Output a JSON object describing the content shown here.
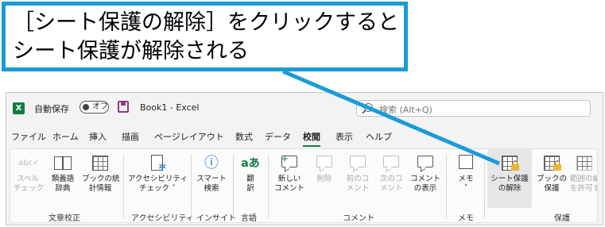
{
  "callout": {
    "line1": "［シート保護の解除］をクリックすると",
    "line2": "シート保護が解除される",
    "color": "#1a9bd7"
  },
  "titlebar": {
    "app_icon": "excel-icon",
    "autosave_label": "自動保存",
    "autosave_state": "オフ",
    "doc_title": "Book1  -  Excel",
    "search_placeholder": "検索 (Alt+Q)"
  },
  "tabs": [
    "ファイル",
    "ホーム",
    "挿入",
    "描画",
    "ページレイアウト",
    "数式",
    "データ",
    "校閲",
    "表示",
    "ヘルプ"
  ],
  "active_tab": "校閲",
  "ribbon": {
    "groups": [
      {
        "label": "文章校正",
        "commands": [
          {
            "icon": "spellcheck-icon",
            "l1": "スペル",
            "l2": "チェック",
            "disabled": true
          },
          {
            "icon": "thesaurus-icon",
            "l1": "類義語",
            "l2": "辞典",
            "disabled": false
          },
          {
            "icon": "workbook-statistics-icon",
            "l1": "ブックの統",
            "l2": "計情報",
            "disabled": false
          }
        ]
      },
      {
        "label": "アクセシビリティ",
        "commands": [
          {
            "icon": "accessibility-icon",
            "l1": "アクセシビリティ",
            "l2": "チェック ˅",
            "disabled": false
          }
        ]
      },
      {
        "label": "インサイト",
        "commands": [
          {
            "icon": "smart-lookup-icon",
            "l1": "スマート",
            "l2": "検索",
            "disabled": false
          }
        ]
      },
      {
        "label": "言語",
        "commands": [
          {
            "icon": "translate-icon",
            "l1": "翻",
            "l2": "訳",
            "disabled": false
          }
        ]
      },
      {
        "label": "コメント",
        "commands": [
          {
            "icon": "new-comment-icon",
            "l1": "新しい",
            "l2": "コメント",
            "disabled": false
          },
          {
            "icon": "delete-comment-icon",
            "l1": "削除",
            "l2": "",
            "disabled": true
          },
          {
            "icon": "previous-comment-icon",
            "l1": "前のコ",
            "l2": "メント",
            "disabled": true
          },
          {
            "icon": "next-comment-icon",
            "l1": "次のコ",
            "l2": "メント",
            "disabled": true
          },
          {
            "icon": "show-comments-icon",
            "l1": "コメント",
            "l2": "の表示",
            "disabled": false
          }
        ]
      },
      {
        "label": "メモ",
        "commands": [
          {
            "icon": "notes-icon",
            "l1": "メモ",
            "l2": "˅",
            "disabled": false
          }
        ]
      },
      {
        "label": "保護",
        "commands": [
          {
            "icon": "unprotect-sheet-icon",
            "l1": "シート保護",
            "l2": "の解除",
            "disabled": false
          },
          {
            "icon": "protect-workbook-icon",
            "l1": "ブックの",
            "l2": "保護",
            "disabled": false
          },
          {
            "icon": "allow-edit-ranges-icon",
            "l1": "範囲の編集",
            "l2": "を許可する",
            "disabled": true
          }
        ]
      }
    ]
  }
}
